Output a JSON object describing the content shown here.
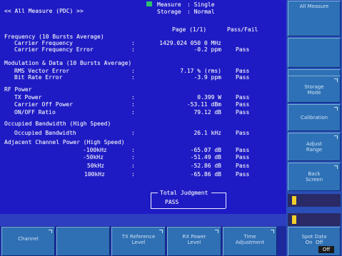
{
  "header": {
    "title": "<< All Measure (PDC) >>",
    "measure_label": "Measure",
    "measure_value": ": Single",
    "storage_label": "Storage",
    "storage_value": ": Normal",
    "page_indicator": "Page (1/1)",
    "pass_fail_heading": "Pass/Fail"
  },
  "sections": {
    "frequency": {
      "title": "Frequency (10 Bursts Average)",
      "rows": [
        {
          "label": "Carrier Frequency",
          "colon": ":",
          "value": "1429.024 050 0 MHz",
          "judgment": ""
        },
        {
          "label": "Carrier Frequency Error",
          "colon": ":",
          "value": "-0.2 ppm",
          "judgment": "Pass"
        }
      ]
    },
    "modulation": {
      "title": "Modulation & Data (10 Bursts Average)",
      "rows": [
        {
          "label": "RMS Vector Error",
          "colon": ":",
          "value": "7.17 % (rms)",
          "judgment": "Pass"
        },
        {
          "label": "Bit Rate Error",
          "colon": ":",
          "value": "-3.9 ppm",
          "judgment": "Pass"
        }
      ]
    },
    "rf_power": {
      "title": "RF Power",
      "rows": [
        {
          "label": "TX Power",
          "colon": ":",
          "value": "0.399 W",
          "judgment": "Pass"
        },
        {
          "label": "Carrier Off Power",
          "colon": ":",
          "value": "-53.11 dBm",
          "judgment": "Pass"
        },
        {
          "label": "ON/OFF Ratio",
          "colon": ":",
          "value": "79.12 dB",
          "judgment": "Pass"
        }
      ]
    },
    "obw": {
      "title": "Occupied Bandwidth (High Speed)",
      "rows": [
        {
          "label": "Occupied Bandwidth",
          "colon": ":",
          "value": "26.1 kHz",
          "judgment": "Pass"
        }
      ]
    },
    "acp": {
      "title": "Adjacent Channel Power (High Speed)",
      "rows": [
        {
          "label": "-100kHz",
          "colon": ":",
          "value": "-65.07 dB",
          "judgment": "Pass"
        },
        {
          "label": "-50kHz",
          "colon": ":",
          "value": "-51.49 dB",
          "judgment": "Pass"
        },
        {
          "label": "50kHz",
          "colon": ":",
          "value": "-52.86 dB",
          "judgment": "Pass"
        },
        {
          "label": "100kHz",
          "colon": ":",
          "value": "-65.86 dB",
          "judgment": "Pass"
        }
      ]
    }
  },
  "total_judgment": {
    "title": "Total Judgment",
    "value": "PASS"
  },
  "right_softkeys": [
    {
      "label": "All Measure"
    },
    {
      "label": ""
    },
    {
      "label": ""
    },
    {
      "label": "Storage\nMode"
    },
    {
      "label": "Calibration"
    },
    {
      "label": "Adjust\nRange"
    },
    {
      "label": "Back\nScreen"
    }
  ],
  "bottom_softkeys": [
    {
      "label": "Channel"
    },
    {
      "label": ""
    },
    {
      "label": "TX Reference\nLevel"
    },
    {
      "label": "RX Power\nLevel"
    },
    {
      "label": "Time\nAdjustment"
    },
    {
      "label": "Spot Data\nOn  Off"
    }
  ],
  "off_badge": "Off",
  "colors": {
    "screen_background": "#1f1cc6",
    "text": "#f0f2f8",
    "softkey": "#2e71b6",
    "indicator_green": "#2fc26a",
    "indicator_yellow": "#f1d02a"
  }
}
